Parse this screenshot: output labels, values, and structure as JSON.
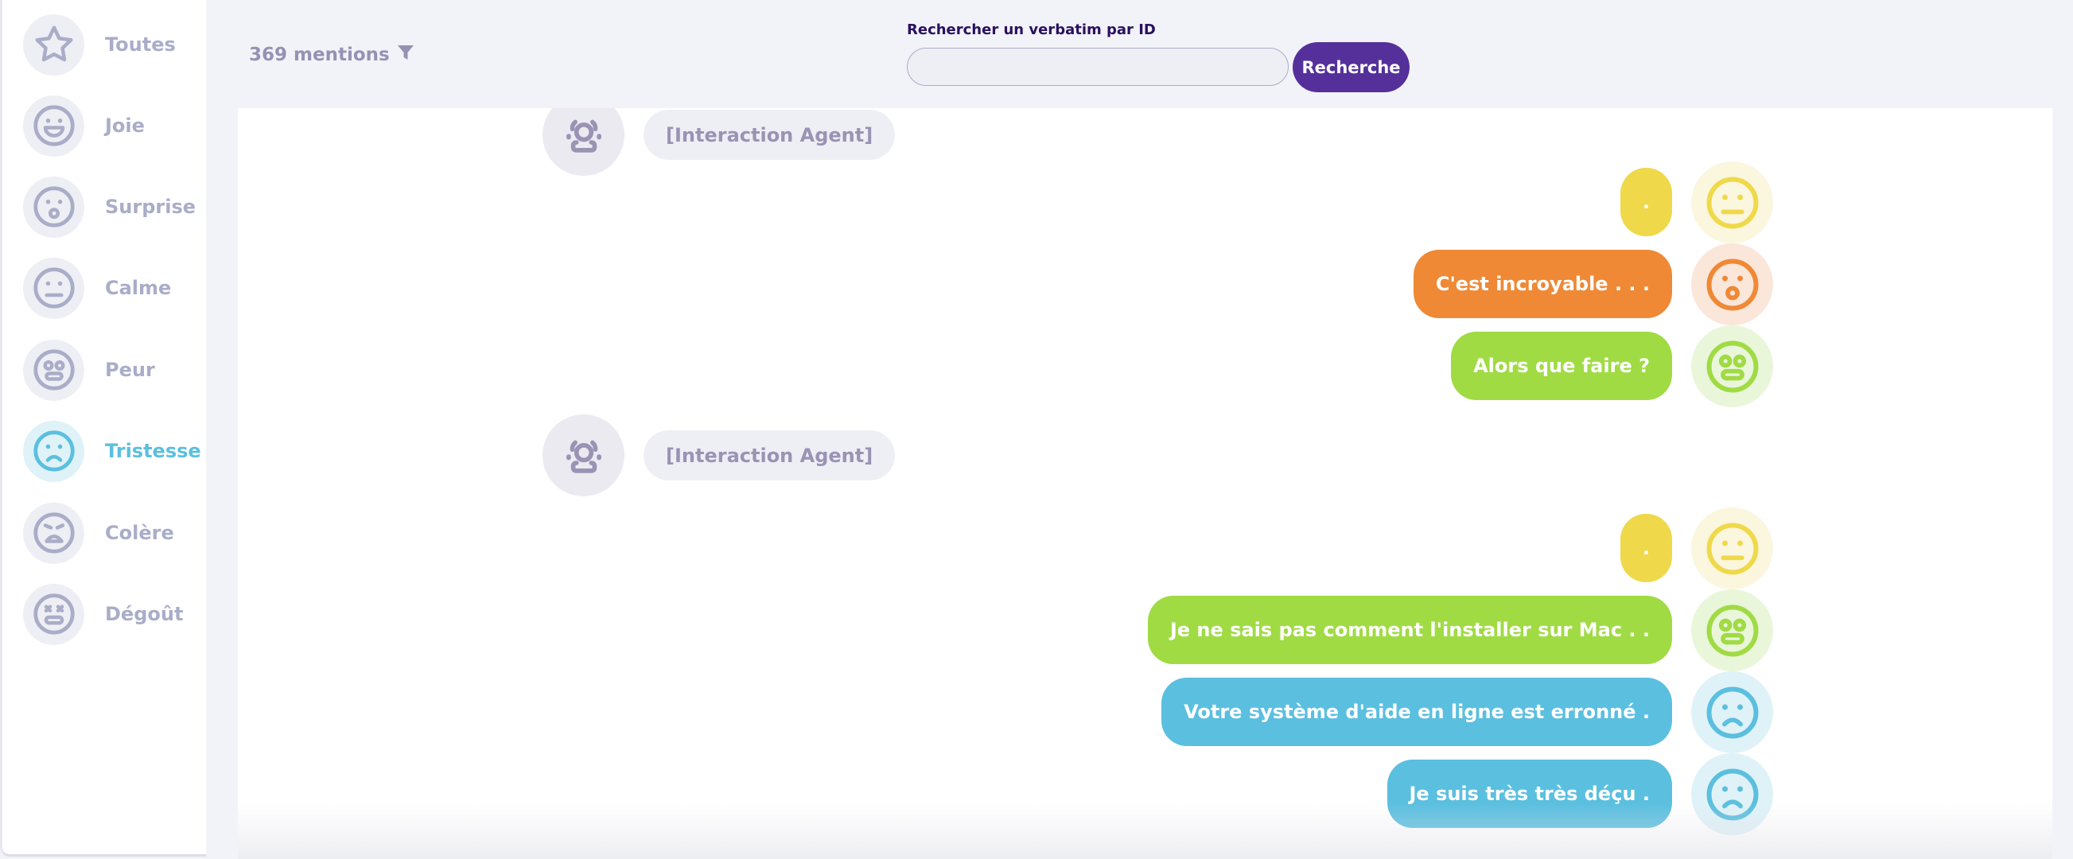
{
  "sidebar": {
    "active": "tristesse",
    "items": [
      {
        "label": "Toutes",
        "icon": "star"
      },
      {
        "label": "Joie",
        "icon": "joie"
      },
      {
        "label": "Surprise",
        "icon": "surprise"
      },
      {
        "label": "Calme",
        "icon": "calme"
      },
      {
        "label": "Peur",
        "icon": "peur"
      },
      {
        "label": "Tristesse",
        "icon": "tristesse"
      },
      {
        "label": "Colère",
        "icon": "colere"
      },
      {
        "label": "Dégoût",
        "icon": "degout"
      }
    ]
  },
  "header": {
    "mentions": "369 mentions",
    "filter_icon": "filter-icon"
  },
  "search": {
    "label": "Rechercher un verbatim par ID",
    "placeholder": "",
    "value": "",
    "button": "Recherche"
  },
  "colors": {
    "accent": "#55309a",
    "calme": "#efd94a",
    "surprise": "#ef8935",
    "peur": "#a0db44",
    "tristesse": "#5bbfdf",
    "inactive": "#a9adc8"
  },
  "conversation": [
    {
      "type": "agent",
      "label": "[Interaction Agent]"
    },
    {
      "type": "customer",
      "text": ".",
      "emotion": "calme"
    },
    {
      "type": "customer",
      "text": "C'est incroyable . . .",
      "emotion": "surprise"
    },
    {
      "type": "customer",
      "text": "Alors que faire ?",
      "emotion": "peur"
    },
    {
      "type": "agent",
      "label": "[Interaction Agent]"
    },
    {
      "type": "customer",
      "text": ".",
      "emotion": "calme"
    },
    {
      "type": "customer",
      "text": "Je ne sais pas comment l'installer sur Mac . .",
      "emotion": "peur"
    },
    {
      "type": "customer",
      "text": "Votre système d'aide en ligne est erronné .",
      "emotion": "tristesse"
    },
    {
      "type": "customer",
      "text": "Je suis très très déçu .",
      "emotion": "tristesse"
    }
  ]
}
